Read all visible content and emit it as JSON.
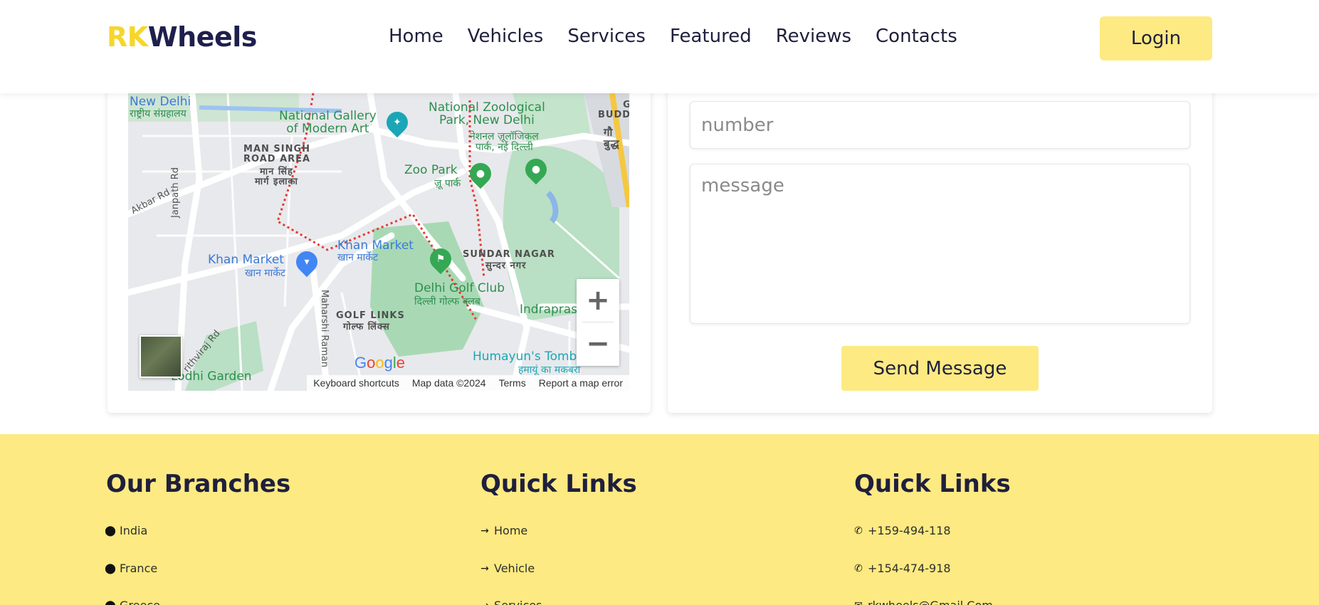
{
  "header": {
    "logo_part1": "RK",
    "logo_part2": "Wheels",
    "nav": [
      "Home",
      "Vehicles",
      "Services",
      "Featured",
      "Reviews",
      "Contacts"
    ],
    "login_label": "Login"
  },
  "map": {
    "labels": {
      "new_delhi": "New Delhi",
      "new_delhi_hi": "राष्ट्रीय संग्रहालय",
      "ngma": "National Gallery\nof Modern Art",
      "zoo": "National Zoological\nPark, New Delhi",
      "zoo_hi": "नेशनल ज़ूलॉजिकल\nपार्क, नई दिल्ली",
      "gau": "GAU\nBUDDHA",
      "gau_hi": "गौ\nबुद्ध",
      "man_singh": "MAN SINGH\nROAD AREA",
      "man_singh_hi": "मान सिंह\nमार्ग इलाका",
      "zoo_park": "Zoo Park",
      "zoo_park_hi": "ज़ू पार्क",
      "akbar_rd": "Akbar Rd",
      "janpath_rd": "Janpath Rd",
      "khan_market_1": "Khan Market",
      "khan_market_1_hi": "खान मार्केट",
      "khan_market_2": "Khan Market",
      "khan_market_2_hi": "खान मार्केट",
      "sundar_nagar": "SUNDAR NAGAR",
      "sundar_nagar_hi": "सुन्दर नगर",
      "golf_club": "Delhi Golf Club",
      "golf_club_hi": "दिल्ली गोल्फ क्लब",
      "golf_links": "GOLF LINKS",
      "golf_links_hi": "गोल्फ लिंक्स",
      "prithviraj_rd": "rithviraj Rd",
      "maharshi_raman": "Maharshi Raman",
      "indraprastha": "Indraprastha",
      "humayun": "Humayun's Tomb",
      "humayun_hi": "हमायूं का मकबरा",
      "lodhi": "Lodhi Garden"
    },
    "zoom_in": "+",
    "zoom_out": "−",
    "google": [
      "G",
      "o",
      "o",
      "g",
      "l",
      "e"
    ],
    "google_colors": [
      "#4285f4",
      "#ea4335",
      "#fbbc05",
      "#4285f4",
      "#34a853",
      "#ea4335"
    ],
    "attribution": {
      "shortcuts": "Keyboard shortcuts",
      "data": "Map data ©2024",
      "terms": "Terms",
      "report": "Report a map error"
    }
  },
  "form": {
    "number_placeholder": "number",
    "message_placeholder": "message",
    "send_label": "Send Message"
  },
  "footer": {
    "col1": {
      "title": "Our Branches",
      "items": [
        "India",
        "France",
        "Greece"
      ]
    },
    "col2": {
      "title": "Quick Links",
      "items": [
        "Home",
        "Vehicle",
        "Services"
      ]
    },
    "col3": {
      "title": "Quick Links",
      "items": [
        "+159-494-118",
        "+154-474-918",
        "rkwheels@Gmail.Com"
      ]
    }
  },
  "colors": {
    "accent_yellow": "#fdea82",
    "logo_yellow": "#f7d62a",
    "navy": "#1f1f4d"
  }
}
